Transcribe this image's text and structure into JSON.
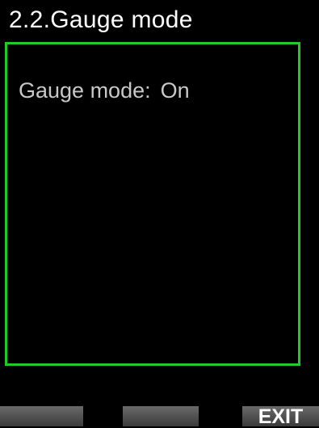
{
  "header": {
    "title": "2.2.Gauge mode"
  },
  "setting": {
    "label": "Gauge mode:",
    "value": "On"
  },
  "softkeys": {
    "left_label": "",
    "middle_label": "",
    "right_label": "EXIT"
  },
  "colors": {
    "background": "#000000",
    "frame_border": "#22c92a",
    "title_text": "#ffffff",
    "setting_text": "#c8c8c8",
    "softkey_background": "#5a5a5a"
  }
}
